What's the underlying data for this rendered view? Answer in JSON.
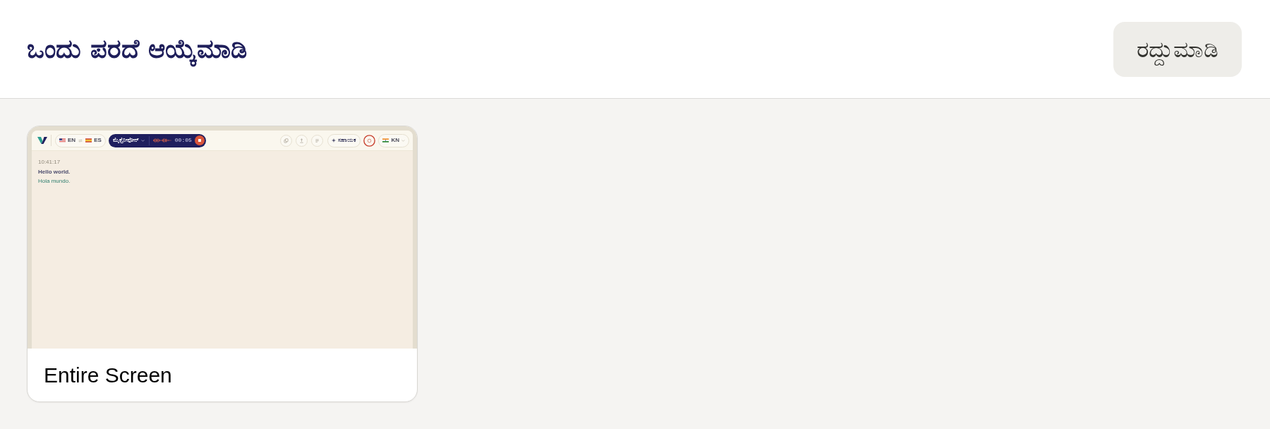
{
  "dialog": {
    "title": "ಒಂದು ಪರದೆ ಆಯ್ಕೆಮಾಡಿ",
    "cancel_button": "ರದ್ದುಮಾಡಿ"
  },
  "sources": [
    {
      "kind": "screen",
      "label": "Entire Screen",
      "selected": false,
      "preview": {
        "source_language": "EN",
        "target_language": "ES",
        "input_label": "ಮೈಕ್ರೋಫೋನ್",
        "timer": "00:05",
        "assistant_button": "ಸಹಾಯಕ",
        "interface_language": "KN",
        "transcript": [
          {
            "time": "10:41:17",
            "original": "Hello world.",
            "translation": "Hola mundo."
          }
        ]
      }
    }
  ]
}
